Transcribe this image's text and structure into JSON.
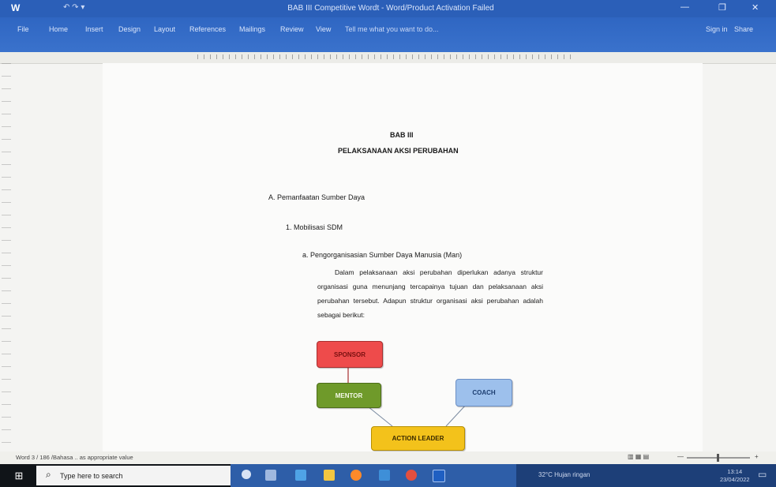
{
  "titlebar": {
    "app_logo": "W",
    "doc_title": "BAB III Competitive Wordt - Word/Product Activation Failed",
    "controls": [
      "—",
      "❐",
      "✕"
    ]
  },
  "ribbon": {
    "tabs": [
      "File",
      "Home",
      "Insert",
      "Design",
      "Layout",
      "References",
      "Mailings",
      "Review",
      "View"
    ],
    "tell_me": "Tell me what you want to do...",
    "sign_in": "Sign in",
    "share": "Share"
  },
  "document": {
    "chapter": "BAB III",
    "chapter_title": "PELAKSANAAN AKSI PERUBAHAN",
    "section_a": "A.    Pemanfaatan Sumber Daya",
    "section_1": "1.    Mobilisasi SDM",
    "section_a_sub": "a.    Pengorganisasian Sumber Daya Manusia (Man)",
    "paragraph": "Dalam pelaksanaan aksi perubahan diperlukan adanya struktur organisasi guna menunjang tercapainya tujuan dan pelaksanaan aksi perubahan tersebut. Adapun struktur organisasi aksi perubahan adalah sebagai berikut:"
  },
  "org_chart": {
    "sponsor": "SPONSOR",
    "mentor": "MENTOR",
    "coach": "COACH",
    "leader": "ACTION LEADER",
    "colors": {
      "sponsor": "#ee4b4b",
      "mentor": "#6f9a2a",
      "coach": "#9dc0ec",
      "leader": "#f3c21b"
    }
  },
  "statusbar": {
    "left_text": "Word 3 / 186 /Bahasa .. as appropriate value",
    "zoom_label": "—",
    "zoom_plus": "+"
  },
  "taskbar": {
    "start_icon": "windows-icon",
    "search_placeholder": "Type here to search",
    "weather": "32°C Hujan ringan",
    "time": "13:14",
    "date": "23/04/2022",
    "apps": [
      "task-view",
      "edge",
      "file-explorer",
      "store",
      "firefox",
      "chrome",
      "word"
    ]
  }
}
